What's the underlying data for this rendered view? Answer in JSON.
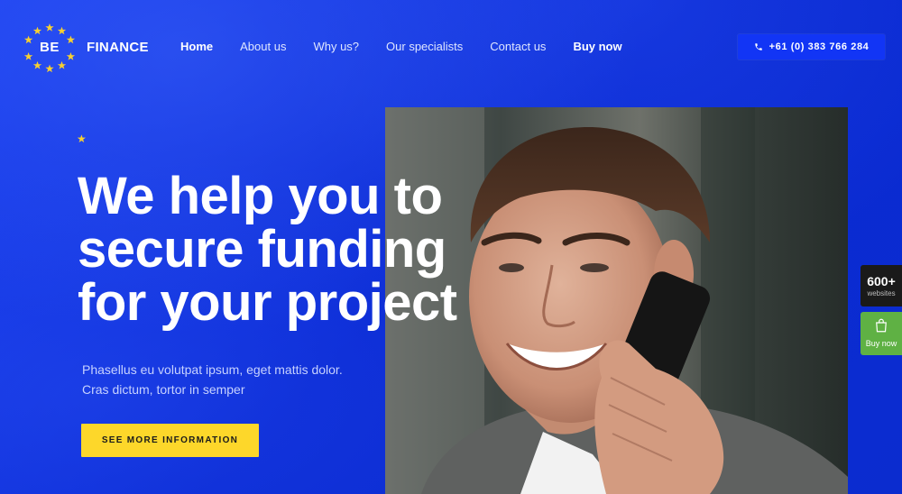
{
  "brand": {
    "be": "BE",
    "name": "FINANCE"
  },
  "nav": [
    {
      "label": "Home"
    },
    {
      "label": "About us"
    },
    {
      "label": "Why us?"
    },
    {
      "label": "Our specialists"
    },
    {
      "label": "Contact us"
    },
    {
      "label": "Buy now"
    }
  ],
  "phone": {
    "number": "+61 (0) 383 766 284",
    "icon": "phone-icon"
  },
  "hero": {
    "title_lines": [
      "We help you to",
      "secure funding",
      "for your project"
    ],
    "subtitle": "Phasellus eu volutpat ipsum, eget mattis dolor. Cras dictum, tortor in semper",
    "cta": "SEE MORE INFORMATION"
  },
  "side": {
    "count": "600+",
    "count_label": "websites",
    "buy_label": "Buy now"
  },
  "colors": {
    "background": "#0a2fd6",
    "accent_yellow": "#fdd72a",
    "star": "#f7d031",
    "buy_green": "#5fb144"
  }
}
